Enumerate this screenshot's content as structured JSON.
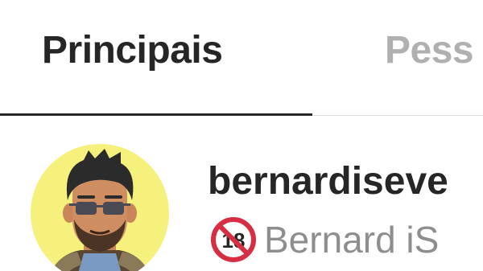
{
  "tabs": [
    {
      "label": "Principais",
      "active": true
    },
    {
      "label": "Pess",
      "active": false
    }
  ],
  "result": {
    "username": "bernardiseve",
    "fullname": "Bernard iS",
    "badge_icon": "no-under-18-icon",
    "avatar_icon": "bitmoji-avatar"
  },
  "colors": {
    "active_text": "#262626",
    "inactive_text": "#b0b0b0",
    "secondary_text": "#8e8e8e",
    "avatar_bg": "#f6f07c",
    "badge_red": "#d62e43"
  }
}
